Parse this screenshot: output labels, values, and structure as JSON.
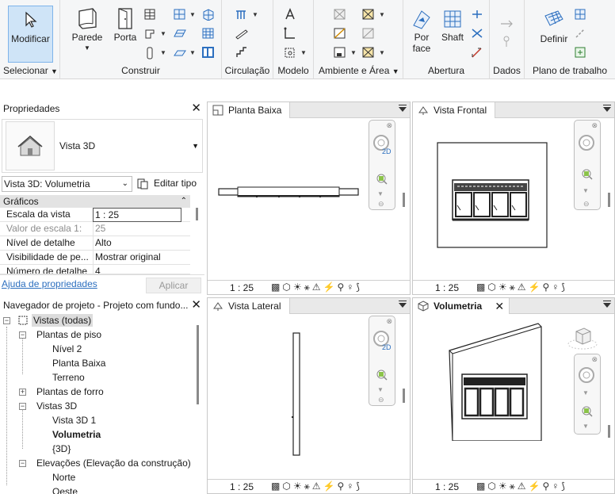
{
  "ribbon": {
    "modificar": "Modificar",
    "selecionar": "Selecionar",
    "parede": "Parede",
    "porta": "Porta",
    "construir": "Construir",
    "circulacao": "Circulação",
    "modelo": "Modelo",
    "ambiente": "Ambiente e Área",
    "por_face_1": "Por",
    "por_face_2": "face",
    "shaft": "Shaft",
    "abertura": "Abertura",
    "dados": "Dados",
    "definir": "Definir",
    "plano": "Plano de trabalho"
  },
  "properties": {
    "title": "Propriedades",
    "type_name": "Vista 3D",
    "selector": "Vista 3D: Volumetria",
    "edit_type": "Editar tipo",
    "section": "Gráficos",
    "rows": [
      {
        "key": "Escala da vista",
        "value": "1 : 25"
      },
      {
        "key": "Valor de escala    1:",
        "value": "25"
      },
      {
        "key": "Nível de detalhe",
        "value": "Alto"
      },
      {
        "key": "Visibilidade de pe...",
        "value": "Mostrar original"
      },
      {
        "key": "Número de detalhe",
        "value": "4"
      }
    ],
    "help_link": "Ajuda de propriedades",
    "apply": "Aplicar"
  },
  "browser": {
    "title": "Navegador de projeto - Projeto com fundo...",
    "nodes": [
      "Vistas (todas)",
      "Plantas de piso",
      "Nível 2",
      "Planta Baixa",
      "Terreno",
      "Plantas de forro",
      "Vistas 3D",
      "Vista 3D 1",
      "Volumetria",
      "{3D}",
      "Elevações (Elevação da construção)",
      "Norte",
      "Oeste"
    ]
  },
  "views": {
    "planta": {
      "title": "Planta Baixa",
      "scale": "1 : 25"
    },
    "frontal": {
      "title": "Vista Frontal",
      "scale": "1 : 25"
    },
    "lateral": {
      "title": "Vista Lateral",
      "scale": "1 : 25"
    },
    "volumetria": {
      "title": "Volumetria",
      "scale": "1 : 25"
    },
    "nav_2d": "2D"
  },
  "colors": {
    "accent": "#2c6fbf",
    "active_button": "#cfe4f7",
    "ribbon_bg": "#f5f6f7"
  }
}
